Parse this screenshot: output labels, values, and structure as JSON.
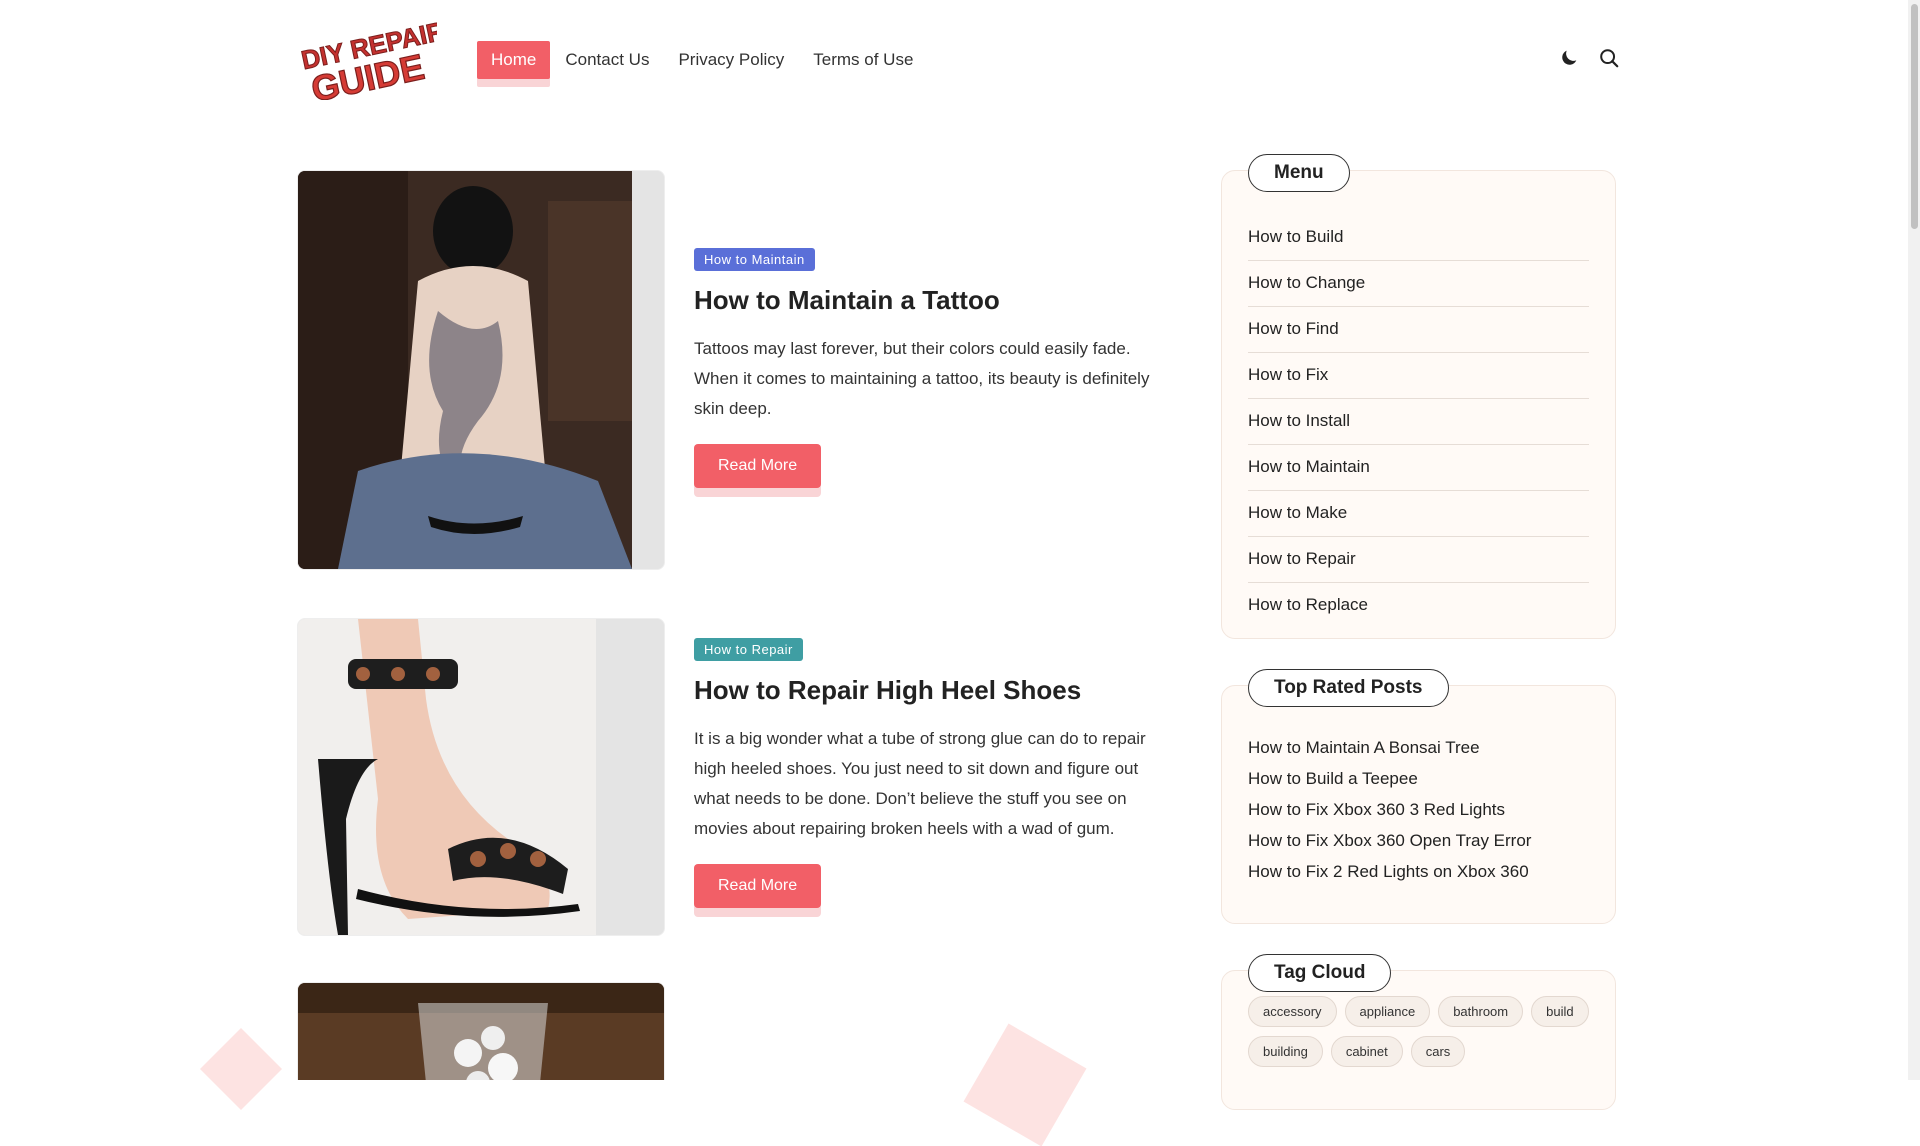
{
  "header": {
    "logo_alt": "DIY REPAIR GUIDE",
    "nav": [
      {
        "label": "Home",
        "active": true
      },
      {
        "label": "Contact Us",
        "active": false
      },
      {
        "label": "Privacy Policy",
        "active": false
      },
      {
        "label": "Terms of Use",
        "active": false
      }
    ],
    "icons": [
      "moon-icon",
      "search-icon"
    ]
  },
  "posts": [
    {
      "category": "How to Maintain",
      "category_color": "#5a6fd8",
      "title": "How to Maintain a Tattoo",
      "excerpt": "Tattoos may last forever, but their colors could easily fade. When it comes to maintaining a tattoo, its beauty is definitely skin deep.",
      "button": "Read More"
    },
    {
      "category": "How to Repair",
      "category_color": "#3f9ea3",
      "title": "How to Repair High Heel Shoes",
      "excerpt": "It is a big wonder what a tube of strong glue can do to repair high heeled shoes. You just need to sit down and figure out what needs to be done. Don’t believe the stuff you see on movies about repairing broken heels with a wad of gum.",
      "button": "Read More"
    }
  ],
  "sidebar": {
    "menu": {
      "title": "Menu",
      "items": [
        "How to Build",
        "How to Change",
        "How to Find",
        "How to Fix",
        "How to Install",
        "How to Maintain",
        "How to Make",
        "How to Repair",
        "How to Replace"
      ]
    },
    "top_rated": {
      "title": "Top Rated Posts",
      "items": [
        "How to Maintain A Bonsai Tree",
        "How to Build a Teepee",
        "How to Fix Xbox 360 3 Red Lights",
        "How to Fix Xbox 360 Open Tray Error",
        "How to Fix 2 Red Lights on Xbox 360"
      ]
    },
    "tag_cloud": {
      "title": "Tag Cloud",
      "tags": [
        "accessory",
        "appliance",
        "bathroom",
        "build",
        "building",
        "cabinet",
        "cars"
      ]
    }
  },
  "colors": {
    "accent": "#f25f67",
    "accent_shadow": "#f9d4d6",
    "widget_bg": "#fffaf6"
  }
}
